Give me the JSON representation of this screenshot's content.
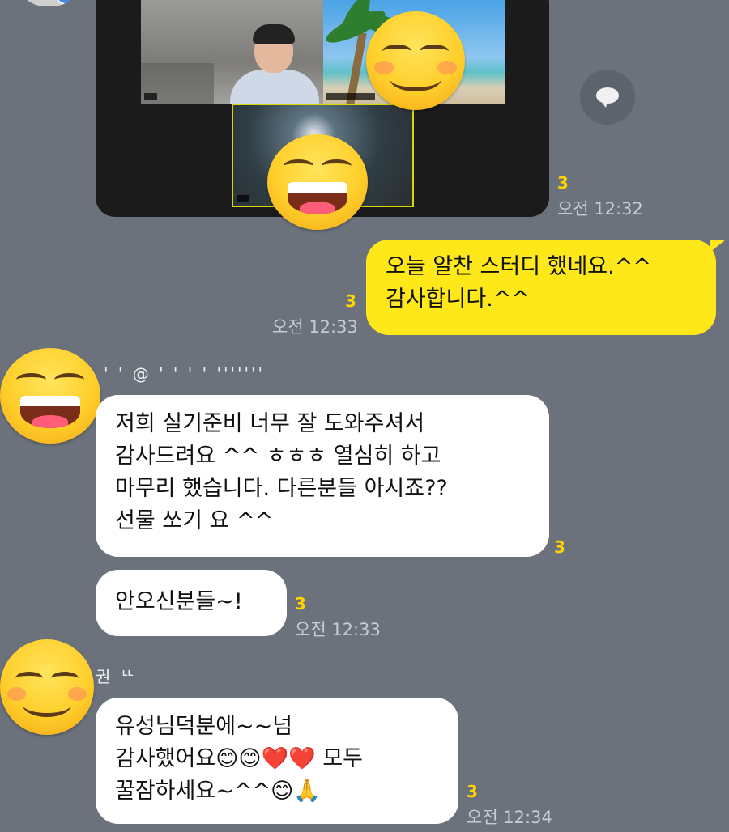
{
  "messages": [
    {
      "type": "image",
      "unread": "3",
      "time": "오전 12:32"
    },
    {
      "type": "outgoing",
      "text": "오늘 알찬 스터디 했네요.^^\n감사합니다.^^",
      "unread": "3",
      "time": "오전 12:33"
    },
    {
      "type": "incoming",
      "sender": "' ' @   '      '   ' '  '''''''",
      "text": "저희 실기준비 너무 잘 도와주셔서\n감사드려요 ^^ ㅎㅎㅎ 열심히 하고\n마무리 했습니다. 다른분들 아시죠??\n선물 쏘기 요 ^^",
      "unread": "3"
    },
    {
      "type": "incoming",
      "text": "안오신분들~!",
      "unread": "3",
      "time": "오전 12:33"
    },
    {
      "type": "incoming",
      "sender": "권                    ᄔ",
      "text": "유성님덕분에~~넘\n감사했어요😊😊❤️❤️ 모두\n꿀잠하세요~^^😊🙏",
      "unread": "3",
      "time": "오전 12:34"
    }
  ],
  "icons": {
    "share": "share-chat-icon",
    "avatar_emoji_1": "grinning-face-emoji",
    "avatar_emoji_2": "smiling-face-with-blush-emoji"
  },
  "colors": {
    "background": "#6b727c",
    "outgoing_bubble": "#ffe81a",
    "incoming_bubble": "#ffffff",
    "unread": "#ffd400"
  }
}
